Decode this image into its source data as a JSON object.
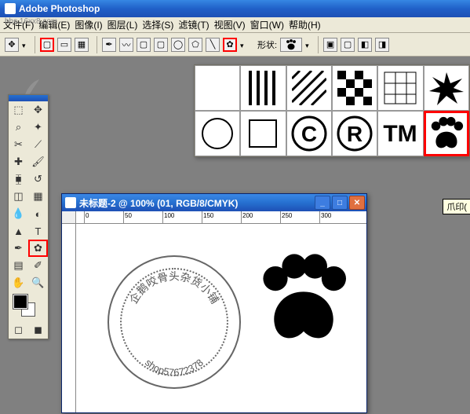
{
  "app": {
    "title": "Adobe Photoshop",
    "watermark": "bbs.16xx8.com"
  },
  "menu": {
    "file": "文件(F)",
    "edit": "编辑(E)",
    "image": "图像(I)",
    "layer": "图层(L)",
    "select": "选择(S)",
    "filter": "滤镜(T)",
    "view": "视图(V)",
    "window": "窗口(W)",
    "help": "帮助(H)"
  },
  "optbar": {
    "shape_label": "形状:"
  },
  "toolbox": {
    "tools": [
      "marquee",
      "move",
      "lasso",
      "wand",
      "crop",
      "slice",
      "healing",
      "brush",
      "stamp",
      "history",
      "eraser",
      "gradient",
      "blur",
      "dodge",
      "path-select",
      "type",
      "pen",
      "shape",
      "notes",
      "eyedrop",
      "hand",
      "zoom"
    ]
  },
  "shape_panel": {
    "cells": [
      "blank",
      "stripes",
      "diag",
      "checker",
      "grid",
      "star",
      "circle",
      "square",
      "copyright",
      "registered",
      "tm",
      "paw"
    ],
    "tooltip": "爪印("
  },
  "doc": {
    "title": "未标题-2 @ 100% (01, RGB/8/CMYK)",
    "ruler_ticks": [
      "0",
      "50",
      "100",
      "150",
      "200",
      "250",
      "300"
    ],
    "stamp": {
      "top_text": "企鹅咬骨头杂货小铺",
      "bottom_text": "shop57672378"
    }
  }
}
